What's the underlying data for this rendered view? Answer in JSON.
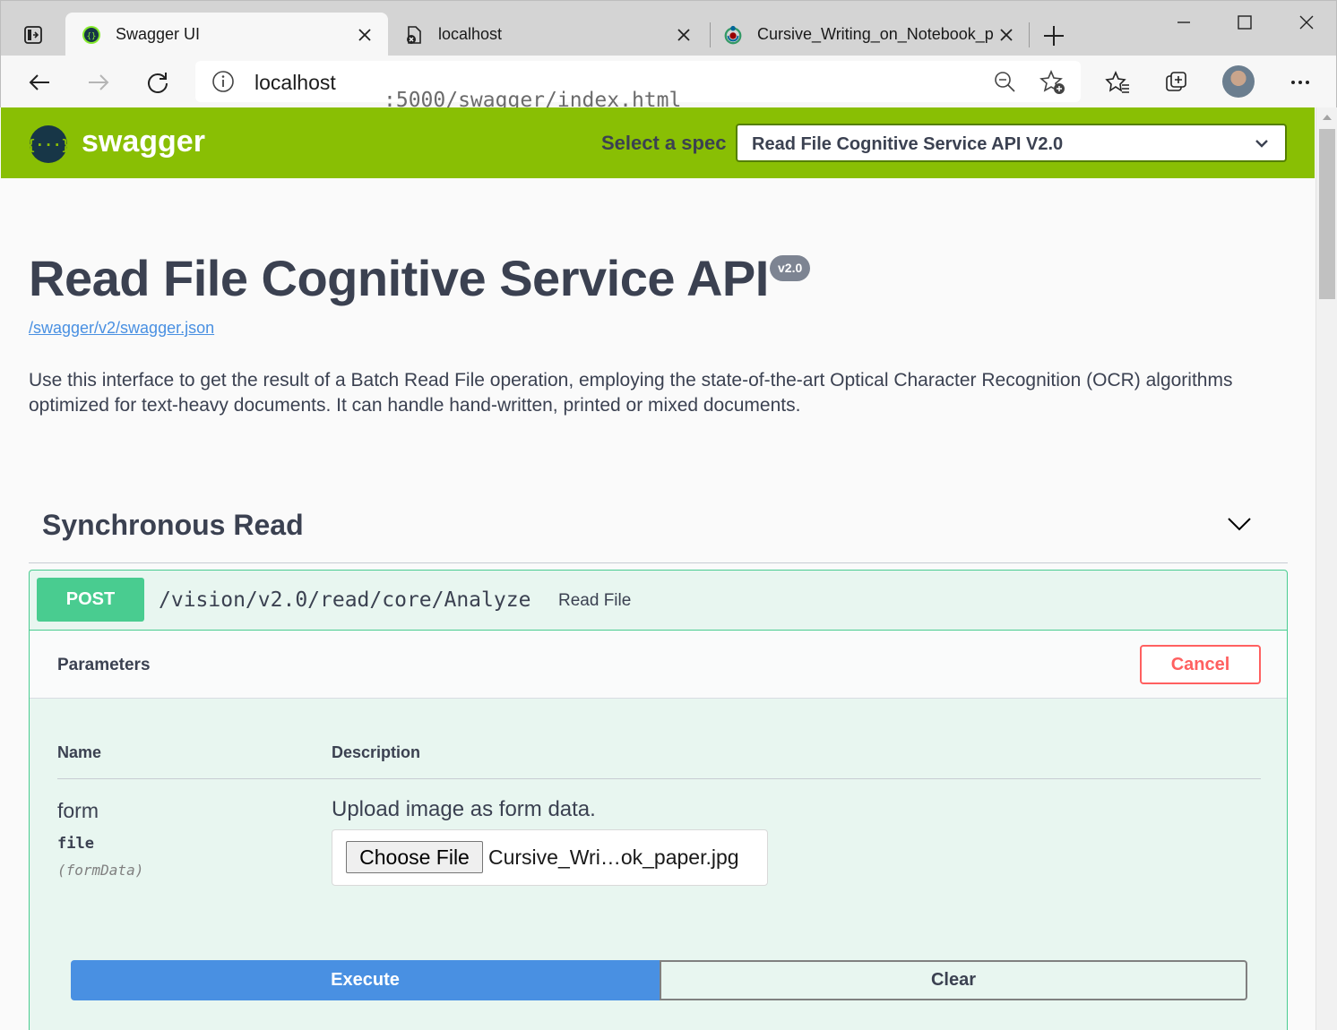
{
  "browser": {
    "tabs": [
      {
        "title": "Swagger UI",
        "active": true
      },
      {
        "title": "localhost",
        "active": false
      },
      {
        "title": "Cursive_Writing_on_Notebook_p",
        "active": false
      }
    ],
    "address": {
      "host": "localhost",
      "path": ":5000/swagger/index.html"
    }
  },
  "topbar": {
    "logo_text": "swagger",
    "logo_glyph": "{···}",
    "spec_label": "Select a spec",
    "spec_selected": "Read File Cognitive Service API V2.0",
    "brand_color": "#89bf04"
  },
  "info": {
    "title": "Read File Cognitive Service API",
    "version": "v2.0",
    "spec_url": "/swagger/v2/swagger.json",
    "description": "Use this interface to get the result of a Batch Read File operation, employing the state-of-the-art Optical Character Recognition (OCR) algorithms optimized for text-heavy documents. It can handle hand-written, printed or mixed documents."
  },
  "tag": {
    "name": "Synchronous Read"
  },
  "operation": {
    "method": "POST",
    "path": "/vision/v2.0/read/core/Analyze",
    "summary": "Read File",
    "parameters_title": "Parameters",
    "cancel_label": "Cancel",
    "columns": {
      "name": "Name",
      "description": "Description"
    },
    "parameter": {
      "name": "form",
      "type": "file",
      "in": "(formData)",
      "description": "Upload image as form data.",
      "choose_label": "Choose File",
      "file_name": "Cursive_Wri…ok_paper.jpg"
    },
    "execute_label": "Execute",
    "clear_label": "Clear",
    "method_color": "#49cc90"
  }
}
